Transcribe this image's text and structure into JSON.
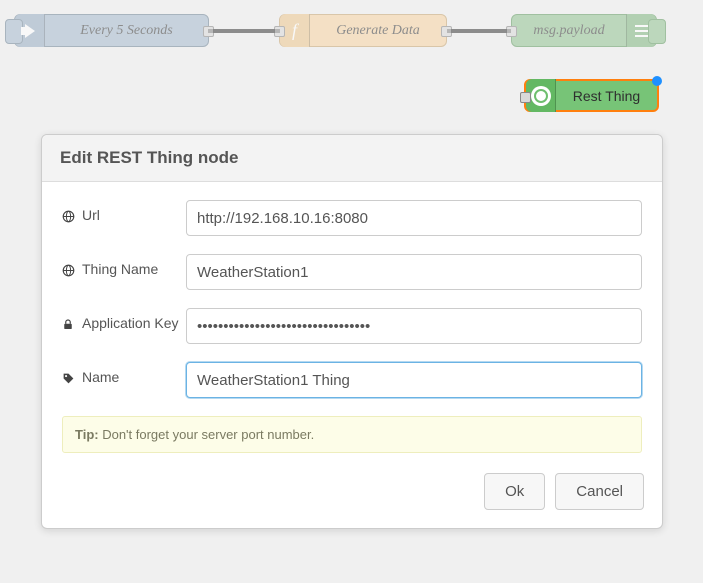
{
  "flow": {
    "inject": {
      "label": "Every 5 Seconds"
    },
    "func": {
      "label": "Generate Data"
    },
    "debug": {
      "label": "msg.payload"
    },
    "rest": {
      "label": "Rest Thing"
    }
  },
  "dialog": {
    "title": "Edit REST Thing node",
    "fields": {
      "url": {
        "label": "Url",
        "value": "http://192.168.10.16:8080"
      },
      "thing": {
        "label": "Thing Name",
        "value": "WeatherStation1"
      },
      "appkey": {
        "label": "Application Key",
        "value": "•••••••••••••••••••••••••••••••••"
      },
      "name": {
        "label": "Name",
        "value": "WeatherStation1 Thing"
      }
    },
    "tip_label": "Tip:",
    "tip_text": " Don't forget your server port number.",
    "buttons": {
      "ok": "Ok",
      "cancel": "Cancel"
    }
  }
}
